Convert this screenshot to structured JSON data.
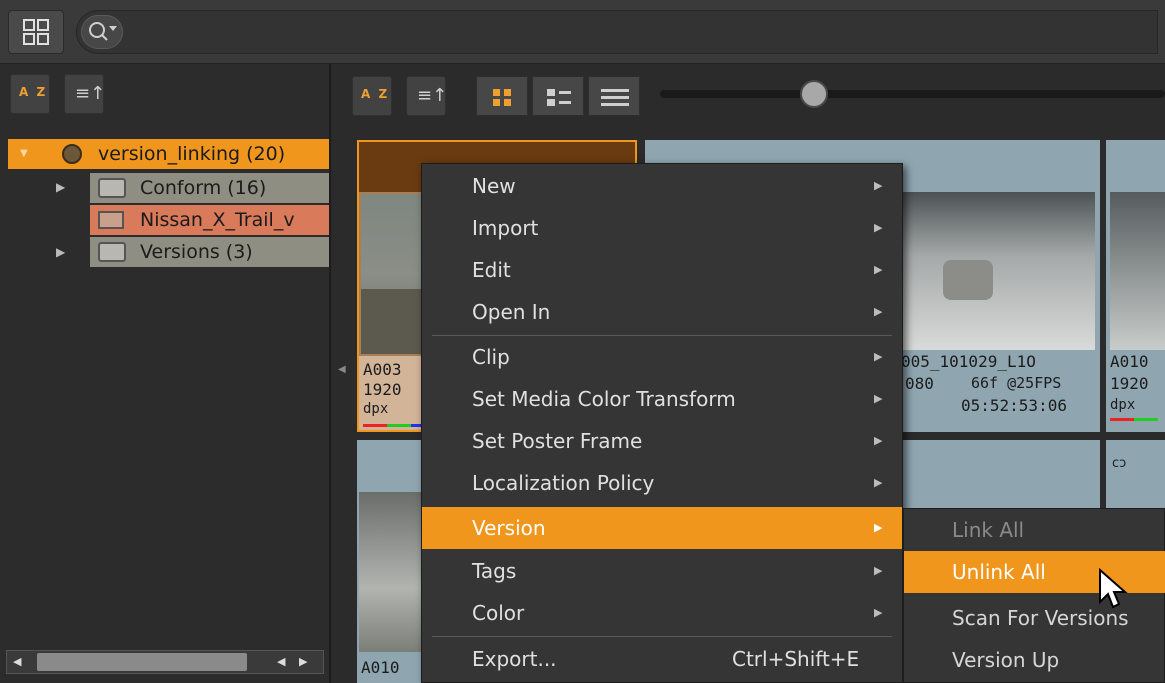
{
  "top_toolbar": {
    "layout_icon": "grid-layout-icon",
    "search_icon": "search-icon"
  },
  "left_panel": {
    "sort_az_label": "A Z",
    "sort_icon": "sort-order-icon",
    "tree": [
      {
        "label": "version_linking (20)",
        "type": "project",
        "selected": true
      },
      {
        "label": "Conform (16)",
        "type": "bin"
      },
      {
        "label": "Nissan_X_Trail_v",
        "type": "sequence",
        "highlighted": true
      },
      {
        "label": "Versions (3)",
        "type": "bin"
      }
    ]
  },
  "right_panel": {
    "sort_az_label": "A Z",
    "view_modes": [
      "thumbnail-view-icon",
      "details-view-icon",
      "list-view-icon"
    ],
    "zoom_slider": 0.3
  },
  "thumbnails": [
    {
      "name": "A003",
      "res": "1920",
      "fmt": "dpx"
    },
    {
      "name": "005_101029_L1O",
      "res": "080",
      "rate": "66f @25FPS",
      "timecode": "05:52:53:06"
    },
    {
      "name": "A010",
      "res": "1920",
      "fmt": "dpx"
    },
    {
      "name": "A010"
    }
  ],
  "context_menu": {
    "items": [
      {
        "label": "New",
        "submenu": true
      },
      {
        "label": "Import",
        "submenu": true
      },
      {
        "label": "Edit",
        "submenu": true
      },
      {
        "label": "Open In",
        "submenu": true
      },
      {
        "label": "Clip",
        "submenu": true
      },
      {
        "label": "Set Media Color Transform",
        "submenu": true
      },
      {
        "label": "Set Poster Frame",
        "submenu": true
      },
      {
        "label": "Localization Policy",
        "submenu": true
      },
      {
        "label": "Version",
        "submenu": true,
        "active": true
      },
      {
        "label": "Tags",
        "submenu": true
      },
      {
        "label": "Color",
        "submenu": true
      },
      {
        "label": "Export...",
        "shortcut": "Ctrl+Shift+E"
      }
    ]
  },
  "version_submenu": {
    "items": [
      {
        "label": "Link All",
        "disabled": true
      },
      {
        "label": "Unlink All",
        "active": true
      },
      {
        "label": "Scan For Versions"
      },
      {
        "label": "Version Up"
      }
    ]
  },
  "colors": {
    "accent": "#f0961c",
    "menu_bg": "#353535",
    "card_bg": "#8fa6b1"
  }
}
